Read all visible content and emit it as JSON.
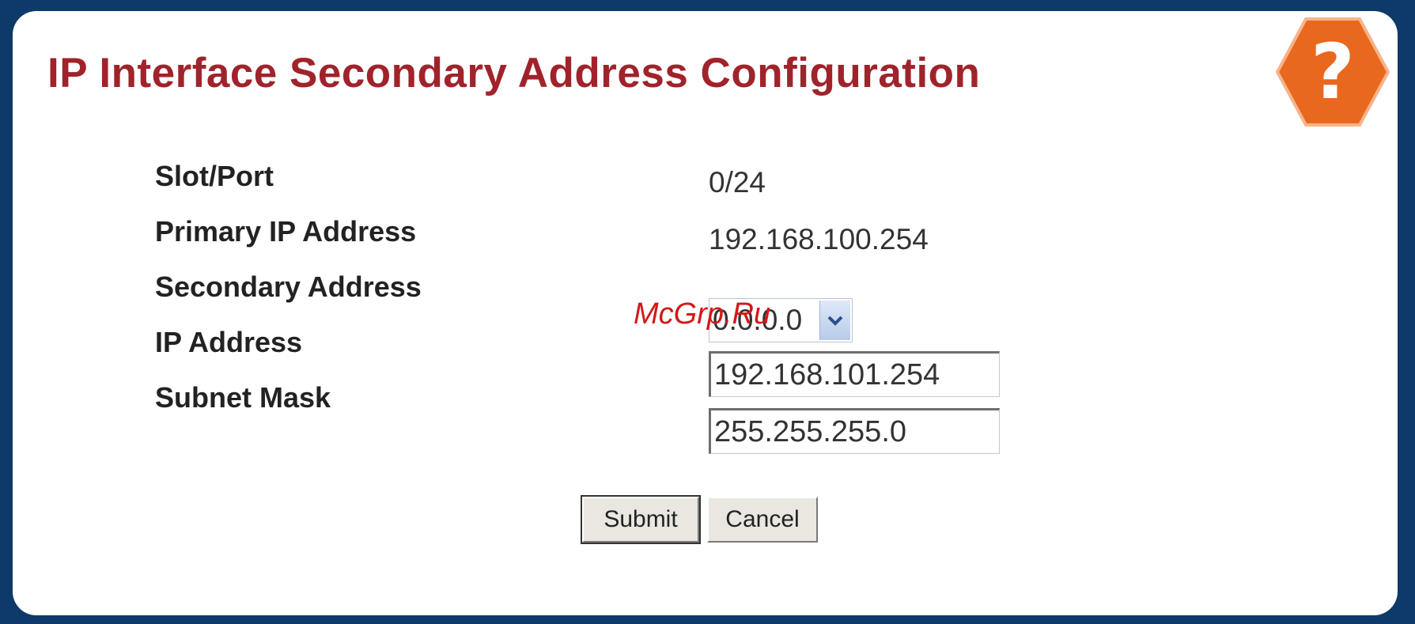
{
  "page": {
    "title": "IP Interface Secondary Address Configuration",
    "help_icon": "help-question-icon"
  },
  "form": {
    "slot_port": {
      "label": "Slot/Port",
      "value": "0/24"
    },
    "primary_ip": {
      "label": "Primary IP Address",
      "value": "192.168.100.254"
    },
    "secondary_address": {
      "label": "Secondary Address",
      "value": "0.0.0.0"
    },
    "ip_address": {
      "label": "IP Address",
      "value": "192.168.101.254"
    },
    "subnet_mask": {
      "label": "Subnet Mask",
      "value": "255.255.255.0"
    }
  },
  "buttons": {
    "submit": "Submit",
    "cancel": "Cancel"
  },
  "watermark": "McGrp.Ru",
  "colors": {
    "background": "#0d3a69",
    "title": "#a0232b",
    "help": "#e8681e"
  }
}
